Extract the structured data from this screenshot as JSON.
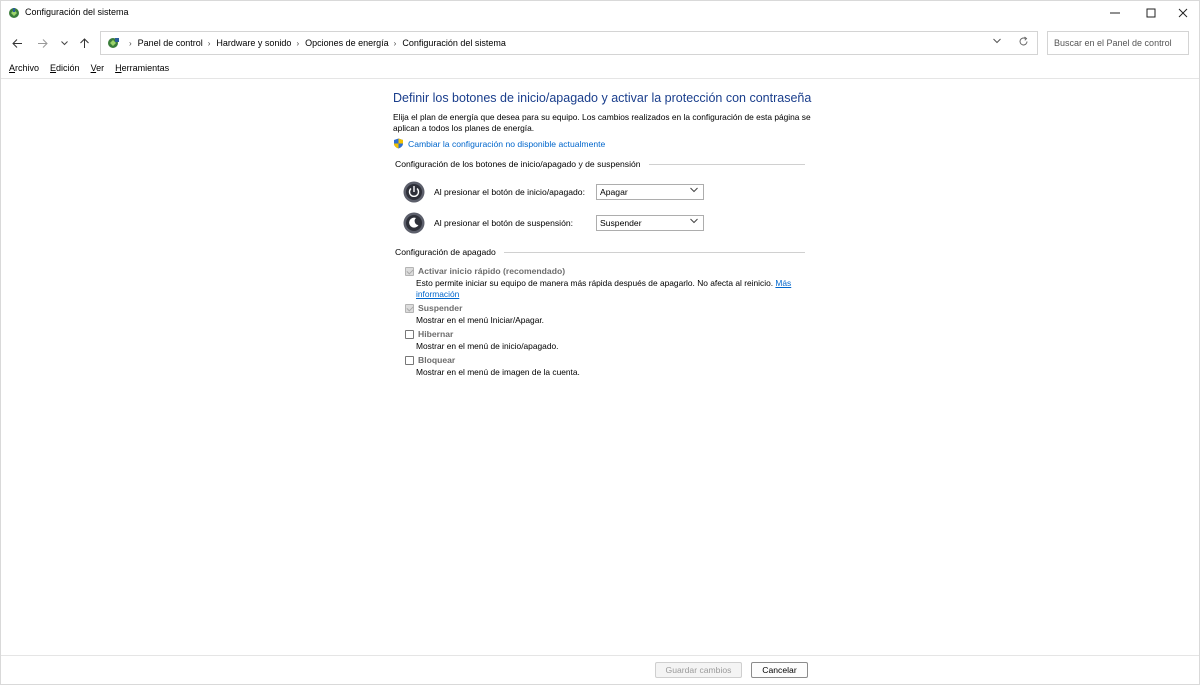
{
  "window": {
    "title": "Configuración del sistema"
  },
  "nav": {
    "breadcrumbs": [
      "Panel de control",
      "Hardware y sonido",
      "Opciones de energía",
      "Configuración del sistema"
    ],
    "search_placeholder": "Buscar en el Panel de control"
  },
  "menu": {
    "items": [
      {
        "accel": "A",
        "rest": "rchivo"
      },
      {
        "accel": "E",
        "rest": "dición"
      },
      {
        "accel": "V",
        "rest": "er"
      },
      {
        "accel": "H",
        "rest": "erramientas"
      }
    ]
  },
  "content": {
    "title": "Definir los botones de inicio/apagado y activar la protección con contraseña",
    "description_line1": "Elija el plan de energía que desea para su equipo. Los cambios realizados en la configuración de esta página se",
    "description_line2": "aplican a todos los planes de energía.",
    "change_link": "Cambiar la configuración no disponible actualmente",
    "section_buttons": "Configuración de los botones de inicio/apagado y de suspensión",
    "power_button_label": "Al presionar el botón de inicio/apagado:",
    "power_button_value": "Apagar",
    "sleep_button_label": "Al presionar el botón de suspensión:",
    "sleep_button_value": "Suspender",
    "section_shutdown": "Configuración de apagado",
    "options": {
      "fast_startup": {
        "name": "Activar inicio rápido (recomendado)",
        "desc": "Esto permite iniciar su equipo de manera más rápida después de apagarlo. No afecta al reinicio.",
        "link_part1": "Más",
        "link_part2": "información"
      },
      "sleep": {
        "name": "Suspender",
        "desc": "Mostrar en el menú Iniciar/Apagar."
      },
      "hibernate": {
        "name": "Hibernar",
        "desc": "Mostrar en el menú de inicio/apagado."
      },
      "lock": {
        "name": "Bloquear",
        "desc": "Mostrar en el menú de imagen de la cuenta."
      }
    }
  },
  "footer": {
    "save_label": "Guardar cambios",
    "cancel_label": "Cancelar"
  },
  "colors": {
    "title_blue": "#1a3e8c",
    "link_blue": "#0066cc"
  }
}
